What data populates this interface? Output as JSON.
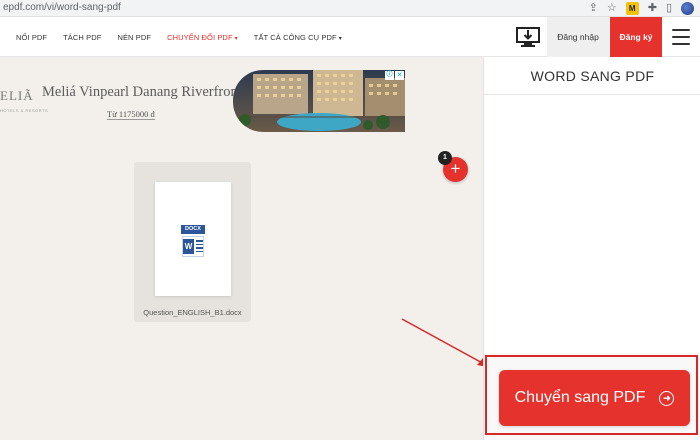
{
  "browser": {
    "url": "epdf.com/vi/word-sang-pdf",
    "icons": [
      "share-icon",
      "star-icon",
      "extension-badge-icon",
      "puzzle-icon",
      "sidebar-icon",
      "profile-avatar"
    ],
    "extension_badge": "M"
  },
  "header": {
    "nav": [
      {
        "label": "NỐI PDF"
      },
      {
        "label": "TÁCH PDF"
      },
      {
        "label": "NÉN PDF"
      },
      {
        "label": "CHUYỂN ĐỔI PDF",
        "caret": "▾",
        "active": true
      },
      {
        "label": "TẤT CẢ CÔNG CỤ PDF",
        "caret": "▾"
      }
    ],
    "login_label": "Đăng nhập",
    "signup_label": "Đăng ký",
    "accent_color": "#e5322d"
  },
  "ad": {
    "brand": "ELIÃ",
    "brand_sub": "HOTELS & RESORTS",
    "title": "Meliá Vinpearl Danang Riverfront",
    "price": "Từ 1175000 đ",
    "info_icon": "ⓘ",
    "close_icon": "✕"
  },
  "file": {
    "type_label": "DOCX",
    "app_letter": "W",
    "name": "Question_ENGLISH_B1.docx"
  },
  "add_button": {
    "count": "1",
    "symbol": "+"
  },
  "panel": {
    "title": "WORD SANG PDF",
    "convert_label": "Chuyển sang PDF",
    "convert_icon": "➜"
  }
}
